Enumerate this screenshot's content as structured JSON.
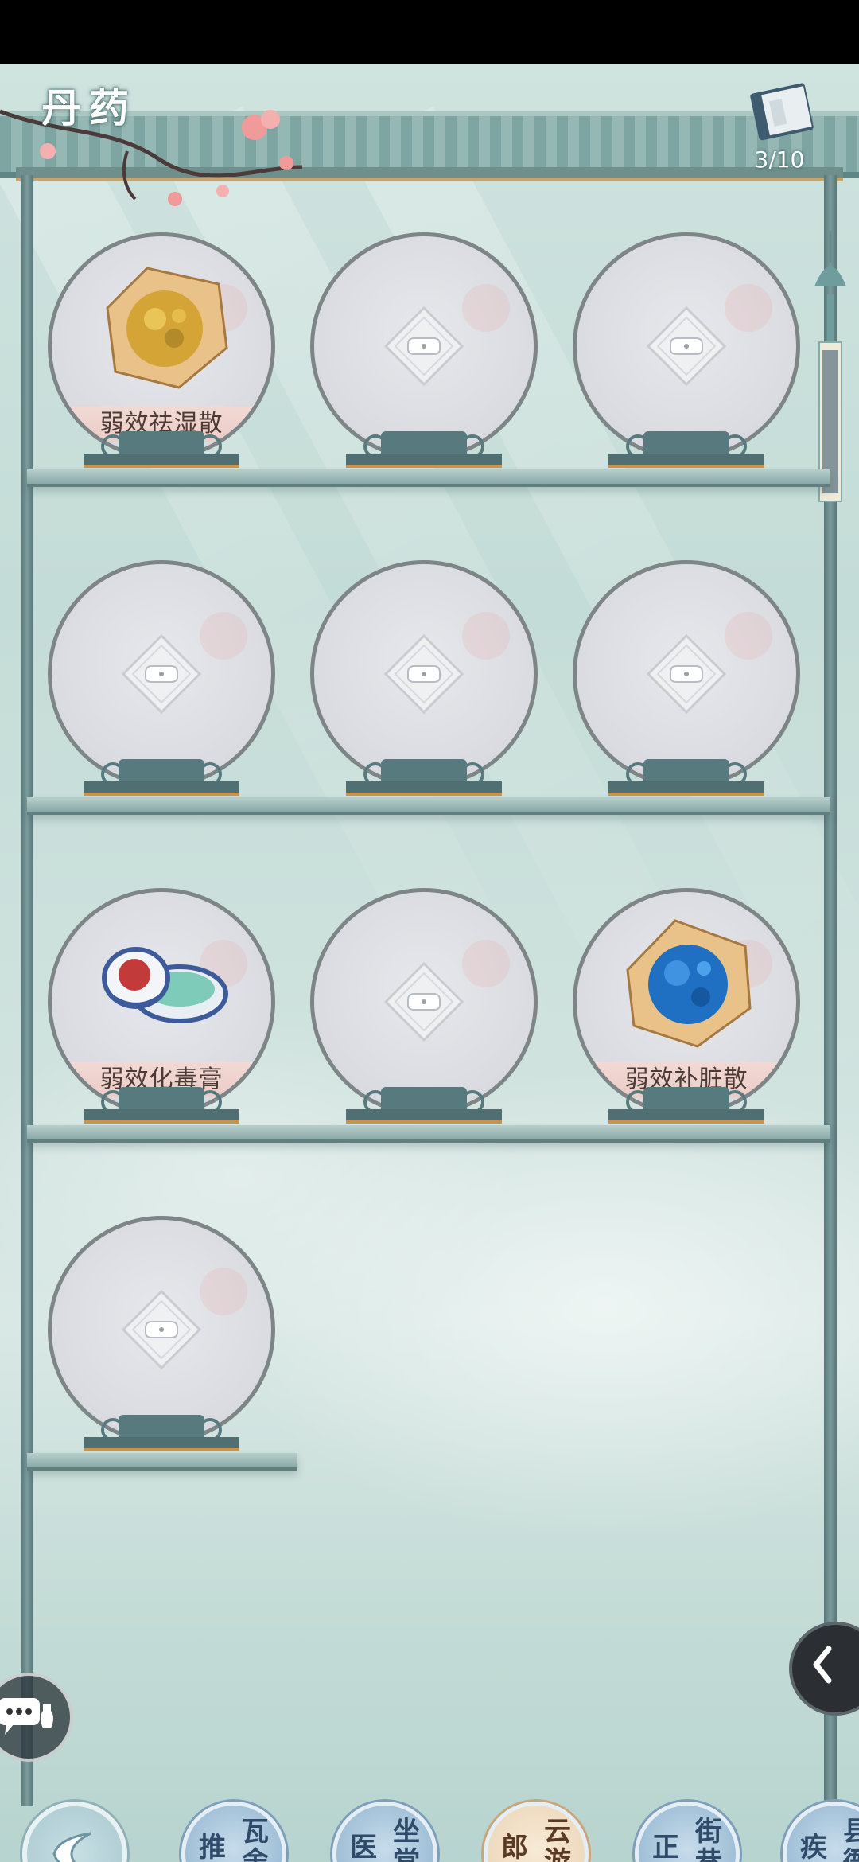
{
  "header": {
    "title": "丹药",
    "progress_text": "3/10"
  },
  "slots": [
    {
      "name": "弱效祛湿散",
      "unlocked": true,
      "icon": "yellow-powder-packet-icon"
    },
    {
      "name": "",
      "unlocked": false,
      "icon": "lock-icon"
    },
    {
      "name": "",
      "unlocked": false,
      "icon": "lock-icon"
    },
    {
      "name": "",
      "unlocked": false,
      "icon": "lock-icon"
    },
    {
      "name": "",
      "unlocked": false,
      "icon": "lock-icon"
    },
    {
      "name": "",
      "unlocked": false,
      "icon": "lock-icon"
    },
    {
      "name": "弱效化毒膏",
      "unlocked": true,
      "icon": "porcelain-ointment-jar-icon"
    },
    {
      "name": "",
      "unlocked": false,
      "icon": "lock-icon"
    },
    {
      "name": "弱效补脏散",
      "unlocked": true,
      "icon": "blue-powder-packet-icon"
    },
    {
      "name": "",
      "unlocked": false,
      "icon": "lock-icon"
    }
  ],
  "nav": {
    "items": [
      {
        "line1": "瓦舍",
        "line2": "推拿",
        "active": false
      },
      {
        "line1": "坐堂",
        "line2": "医工",
        "active": false
      },
      {
        "line1": "云游",
        "line2": "郎中",
        "active": true
      },
      {
        "line1": "街巷",
        "line2": "正骨",
        "active": false
      },
      {
        "line1": "县衙",
        "line2": "疾医",
        "active": false
      }
    ]
  },
  "colors": {
    "accent_gold": "#c9934d",
    "label_pink": "#f2d9d4",
    "disc_border": "#7e8587"
  }
}
